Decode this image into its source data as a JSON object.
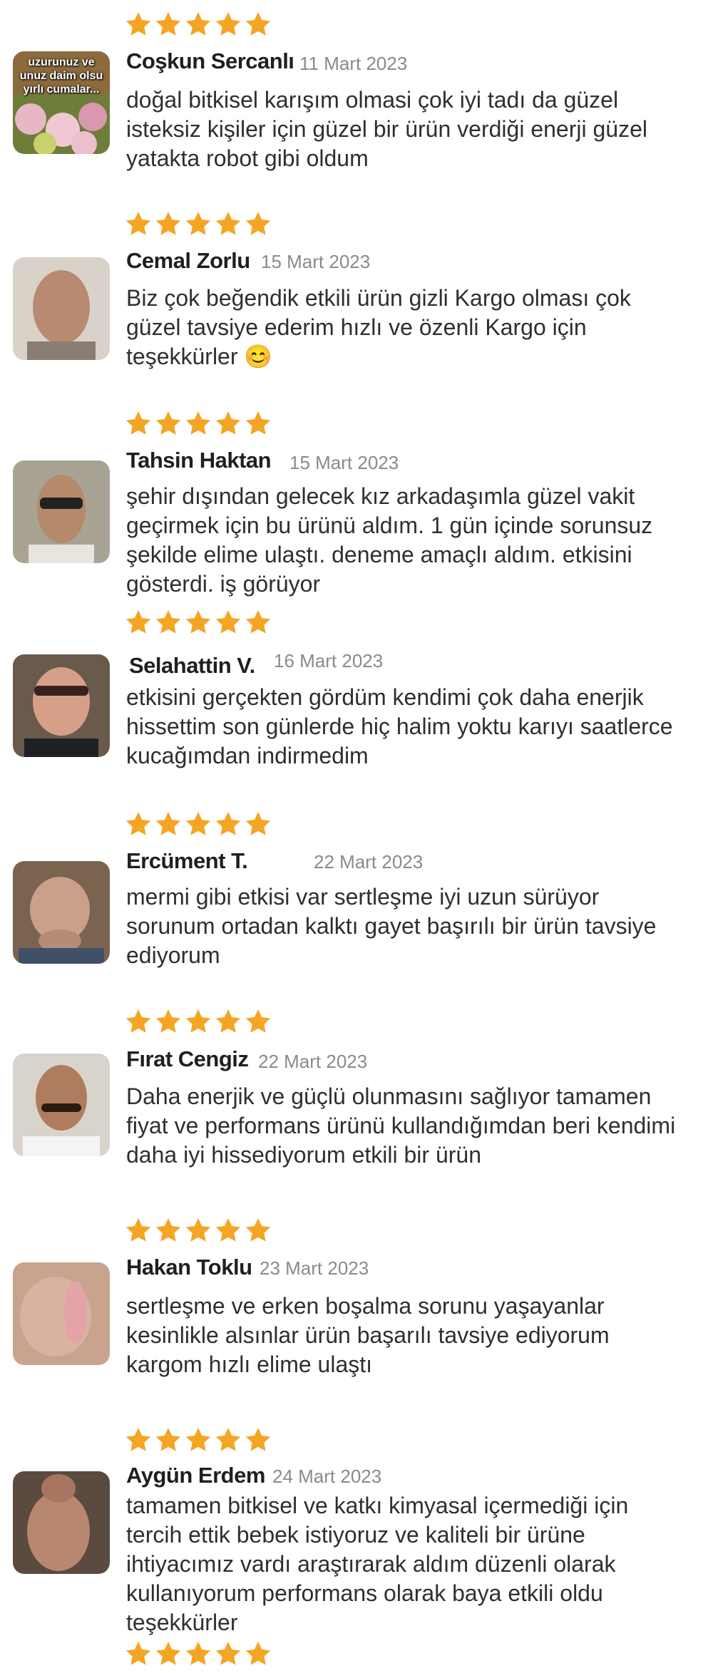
{
  "colors": {
    "star": "#F5A524",
    "name": "#1f1f1f",
    "date": "#8a8a8a",
    "text": "#2f2f2f"
  },
  "reviews": [
    {
      "rating": 5,
      "name": "Coşkun Sercanlı",
      "date": "11 Mart 2023",
      "avatar_caption": "uzurunuz ve\nunuz daim olsu\nyırlı cumalar...",
      "text": "doğal bitkisel karışım olmasi çok iyi tadı da güzel isteksiz kişiler için güzel bir ürün verdiği enerji güzel yatakta robot gibi oldum"
    },
    {
      "rating": 5,
      "name": "Cemal Zorlu",
      "date": "15 Mart 2023",
      "text": "Biz çok beğendik etkili ürün gizli Kargo olması çok güzel tavsiye ederim hızlı ve özenli Kargo için teşekkürler 😊"
    },
    {
      "rating": 5,
      "name": "Tahsin Haktan",
      "date": "15 Mart 2023",
      "text": "şehir dışından gelecek kız arkadaşımla güzel vakit geçirmek için bu ürünü aldım. 1 gün içinde sorunsuz şekilde elime ulaştı. deneme amaçlı aldım. etkisini gösterdi. iş görüyor"
    },
    {
      "rating": 5,
      "name": "Selahattin V.",
      "date": "16 Mart 2023",
      "text": "etkisini gerçekten gördüm kendimi çok daha enerjik hissettim son günlerde hiç halim yoktu karıyı saatlerce kucağımdan indirmedim"
    },
    {
      "rating": 5,
      "name": "Ercüment T.",
      "date": "22 Mart 2023",
      "text": "mermi gibi etkisi var sertleşme iyi uzun sürüyor sorunum ortadan kalktı gayet başırılı bir ürün tavsiye ediyorum"
    },
    {
      "rating": 5,
      "name": "Fırat Cengiz",
      "date": "22 Mart 2023",
      "text": "Daha enerjik ve güçlü olunmasını sağlıyor tamamen fiyat ve performans ürünü kullandığımdan beri kendimi daha iyi hissediyorum etkili bir ürün"
    },
    {
      "rating": 5,
      "name": "Hakan Toklu",
      "date": "23 Mart 2023",
      "text": "sertleşme ve erken boşalma sorunu yaşayanlar kesinlikle alsınlar ürün başarılı tavsiye ediyorum kargom hızlı elime ulaştı"
    },
    {
      "rating": 5,
      "name": "Aygün Erdem",
      "date": "24 Mart 2023",
      "text": "tamamen bitkisel ve katkı kimyasal içermediği için tercih ettik bebek istiyoruz ve kaliteli bir ürüne ihtiyacımız vardı araştırarak aldım düzenli olarak kullanıyorum performans olarak baya etkili oldu teşekkürler"
    },
    {
      "rating": 5
    }
  ]
}
